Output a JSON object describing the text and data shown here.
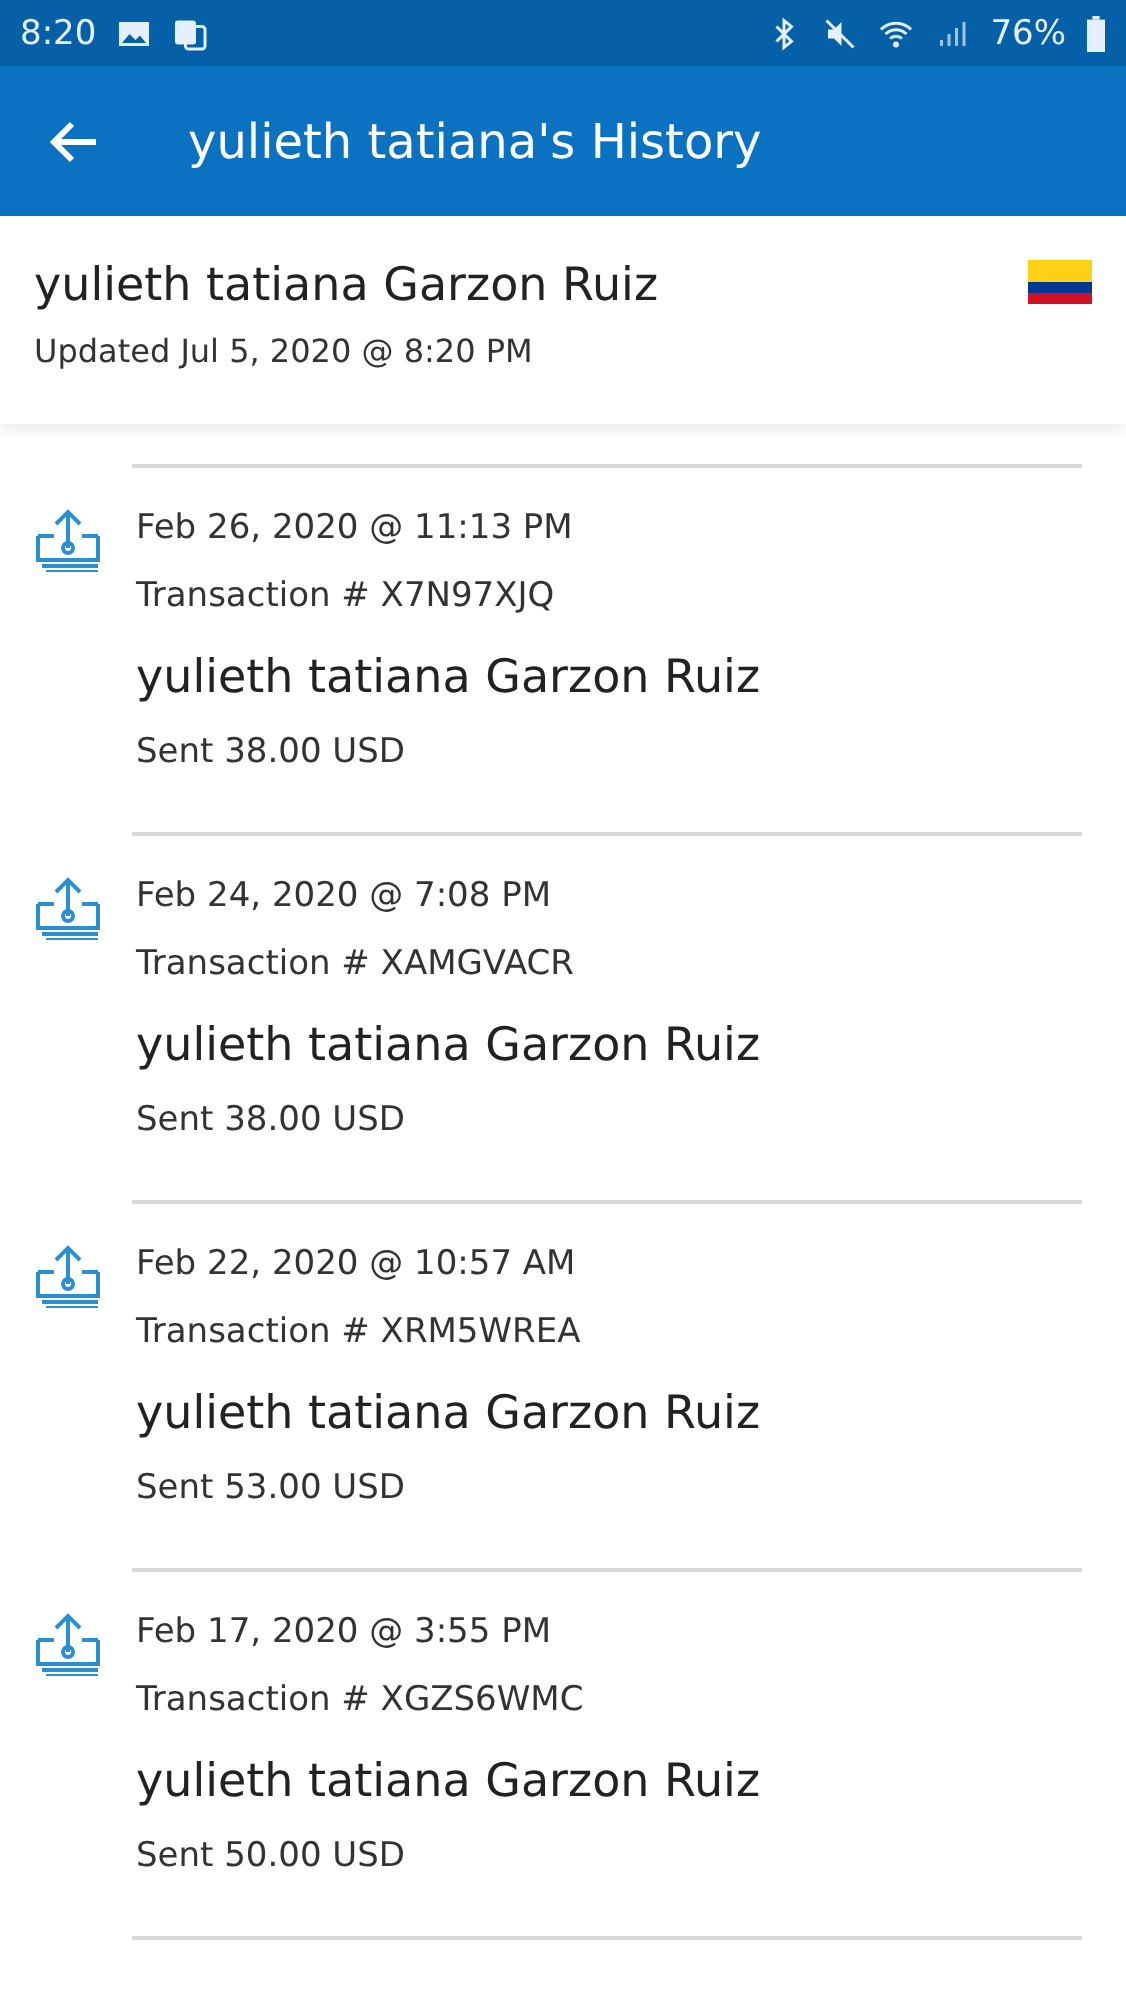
{
  "status_bar": {
    "time": "8:20",
    "battery": "76%"
  },
  "app_bar": {
    "title": "yulieth tatiana's History"
  },
  "header": {
    "name": "yulieth tatiana Garzon Ruiz",
    "updated": "Updated Jul 5, 2020 @ 8:20 PM"
  },
  "transactions": [
    {
      "date": "Feb 26, 2020 @ 11:13 PM",
      "transaction": "Transaction # X7N97XJQ",
      "recipient": "yulieth tatiana Garzon Ruiz",
      "amount": "Sent 38.00 USD"
    },
    {
      "date": "Feb 24, 2020 @ 7:08 PM",
      "transaction": "Transaction # XAMGVACR",
      "recipient": "yulieth tatiana Garzon Ruiz",
      "amount": "Sent 38.00 USD"
    },
    {
      "date": "Feb 22, 2020 @ 10:57 AM",
      "transaction": "Transaction # XRM5WREA",
      "recipient": "yulieth tatiana Garzon Ruiz",
      "amount": "Sent 53.00 USD"
    },
    {
      "date": "Feb 17, 2020 @ 3:55 PM",
      "transaction": "Transaction # XGZS6WMC",
      "recipient": "yulieth tatiana Garzon Ruiz",
      "amount": "Sent 50.00 USD"
    }
  ]
}
